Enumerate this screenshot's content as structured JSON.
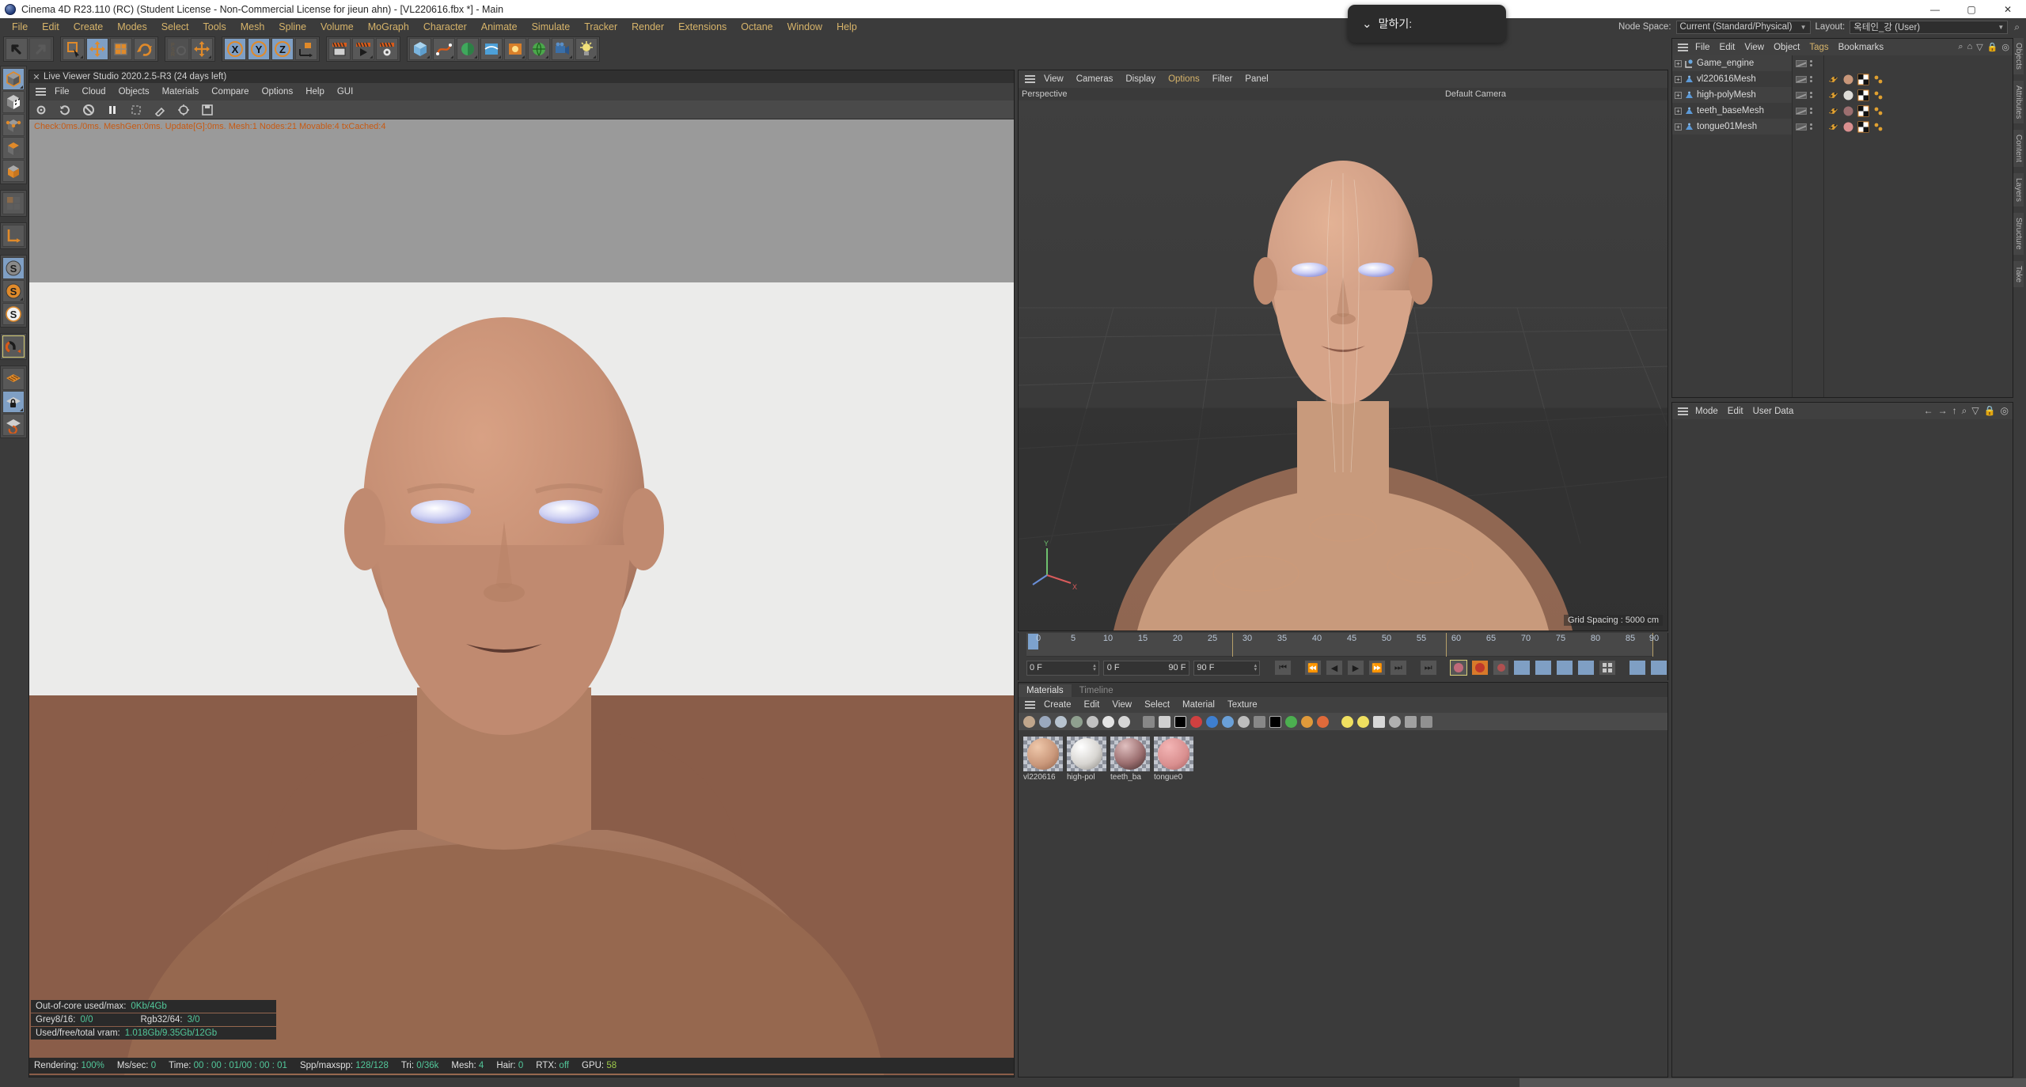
{
  "titlebar": {
    "title": "Cinema 4D R23.110 (RC) (Student License - Non-Commercial License for jieun ahn) - [VL220616.fbx *] - Main",
    "minimize": "—",
    "maximize": "▢",
    "close": "✕"
  },
  "menubar": {
    "items": [
      "File",
      "Edit",
      "Create",
      "Modes",
      "Select",
      "Tools",
      "Mesh",
      "Spline",
      "Volume",
      "MoGraph",
      "Character",
      "Animate",
      "Simulate",
      "Tracker",
      "Render",
      "Extensions",
      "Octane",
      "Window",
      "Help"
    ]
  },
  "topright": {
    "node_space_label": "Node Space:",
    "node_space_value": "Current (Standard/Physical)",
    "layout_label": "Layout:",
    "layout_value": "옥테인_강 (User)",
    "search_icon": "search-icon"
  },
  "speech_overlay": {
    "chevron": "⌄",
    "text": "말하기:"
  },
  "live_viewer": {
    "close_icon": "✕",
    "tab_title": "Live Viewer Studio 2020.2.5-R3 (24 days left)",
    "menu": [
      "File",
      "Cloud",
      "Objects",
      "Materials",
      "Compare",
      "Options",
      "Help",
      "GUI"
    ],
    "stats": "Check:0ms./0ms. MeshGen:0ms. Update[G]:0ms. Mesh:1 Nodes:21 Movable:4 txCached:4",
    "out_of_core": {
      "line1_label": "Out-of-core used/max:",
      "line1_value": "0Kb/4Gb",
      "line2_label_a": "Grey8/16:",
      "line2_value_a": "0/0",
      "line2_label_b": "Rgb32/64:",
      "line2_value_b": "3/0",
      "line3_label": "Used/free/total vram:",
      "line3_value": "1.018Gb/9.35Gb/12Gb"
    },
    "status": {
      "rendering_label": "Rendering:",
      "rendering_value": "100%",
      "mssec_label": "Ms/sec:",
      "mssec_value": "0",
      "time_label": "Time:",
      "time_value": "00 : 00 : 01/00 : 00 : 01",
      "spp_label": "Spp/maxspp:",
      "spp_value": "128/128",
      "tri_label": "Tri:",
      "tri_value": "0/36k",
      "mesh_label": "Mesh:",
      "mesh_value": "4",
      "hair_label": "Hair:",
      "hair_value": "0",
      "rtx_label": "RTX:",
      "rtx_value": "off",
      "gpu_label": "GPU:",
      "gpu_value": "58"
    }
  },
  "viewport": {
    "menu": [
      "View",
      "Cameras",
      "Display",
      "Options",
      "Filter",
      "Panel"
    ],
    "highlighted_menu": "Options",
    "view_name": "Perspective",
    "camera_name": "Default Camera",
    "grid_spacing": "Grid Spacing : 5000 cm"
  },
  "timeline": {
    "ticks": [
      0,
      5,
      10,
      15,
      20,
      25,
      30,
      35,
      40,
      45,
      50,
      55,
      60,
      65,
      70,
      75,
      80,
      85,
      90
    ],
    "current_frame": "0 F",
    "range_start": "0 F",
    "range_end": "90 F",
    "end_frame": "90 F",
    "frame_field": "0 F",
    "transport": [
      "⏮",
      "⏪",
      "◀",
      "▶",
      "⏩",
      "⏭"
    ]
  },
  "materials": {
    "tabs": [
      {
        "label": "Materials",
        "active": true
      },
      {
        "label": "Timeline",
        "active": false
      }
    ],
    "menu": [
      "Create",
      "Edit",
      "View",
      "Select",
      "Material",
      "Texture"
    ],
    "items": [
      {
        "label": "vl220616",
        "color": "#c9977a"
      },
      {
        "label": "high-pol",
        "color": "#d8d6d2"
      },
      {
        "label": "teeth_ba",
        "color": "#9c6f70"
      },
      {
        "label": "tongue0",
        "color": "#d98f8f"
      }
    ]
  },
  "object_manager": {
    "menu": [
      "File",
      "Edit",
      "View",
      "Object",
      "Tags",
      "Bookmarks"
    ],
    "highlighted_menu": "Tags",
    "objects": [
      {
        "name": "Game_engine",
        "type": "null-object",
        "has_tags": false
      },
      {
        "name": "vl220616Mesh",
        "type": "polygon-object",
        "has_tags": true,
        "material_color": "#c9977a"
      },
      {
        "name": "high-polyMesh",
        "type": "polygon-object",
        "has_tags": true,
        "material_color": "#dedcd8"
      },
      {
        "name": "teeth_baseMesh",
        "type": "polygon-object",
        "has_tags": true,
        "material_color": "#9c6f70"
      },
      {
        "name": "tongue01Mesh",
        "type": "polygon-object",
        "has_tags": true,
        "material_color": "#d98f8f"
      }
    ]
  },
  "attributes": {
    "menu": [
      "Mode",
      "Edit",
      "User Data"
    ]
  },
  "right_tabs": [
    "Objects",
    "Attributes",
    "Content",
    "Layers",
    "Structure",
    "Take"
  ],
  "toolbar": {
    "groups": [
      {
        "buttons": [
          {
            "name": "undo-button",
            "icon": "undo",
            "state": "normal"
          },
          {
            "name": "redo-button",
            "icon": "redo",
            "state": "disabled"
          }
        ]
      },
      {
        "buttons": [
          {
            "name": "select-tool",
            "icon": "cursor-square",
            "state": "normal"
          },
          {
            "name": "move-tool",
            "icon": "move-arrows",
            "state": "selected"
          },
          {
            "name": "scale-tool",
            "icon": "scale-box",
            "state": "normal"
          },
          {
            "name": "rotate-tool",
            "icon": "rotate-arc",
            "state": "normal"
          }
        ]
      },
      {
        "buttons": [
          {
            "name": "psr-tool",
            "icon": "psr",
            "state": "disabled"
          },
          {
            "name": "world-axis-tool",
            "icon": "move-arrows",
            "state": "normal"
          }
        ]
      },
      {
        "buttons": [
          {
            "name": "lock-x-axis",
            "icon": "x-axis",
            "state": "selected"
          },
          {
            "name": "lock-y-axis",
            "icon": "y-axis",
            "state": "selected"
          },
          {
            "name": "lock-z-axis",
            "icon": "z-axis",
            "state": "selected"
          },
          {
            "name": "world-object-coord",
            "icon": "cube-axis",
            "state": "normal"
          }
        ]
      },
      {
        "buttons": [
          {
            "name": "render-view-button",
            "icon": "render-view",
            "state": "normal"
          },
          {
            "name": "render-to-picture-viewer-button",
            "icon": "render-picture",
            "state": "normal"
          },
          {
            "name": "render-settings-button",
            "icon": "render-settings",
            "state": "normal"
          }
        ]
      },
      {
        "buttons": [
          {
            "name": "add-cube-button",
            "icon": "cube",
            "state": "normal"
          },
          {
            "name": "add-spline-button",
            "icon": "spline",
            "state": "normal"
          },
          {
            "name": "add-generator-button",
            "icon": "generator",
            "state": "normal"
          },
          {
            "name": "add-deformer-button",
            "icon": "deformer",
            "state": "normal"
          },
          {
            "name": "add-scene-button",
            "icon": "scene",
            "state": "normal"
          },
          {
            "name": "add-camera-button",
            "icon": "camera",
            "state": "normal"
          },
          {
            "name": "add-light-button",
            "icon": "light",
            "state": "normal"
          }
        ]
      }
    ]
  },
  "left_toolbar": {
    "buttons": [
      {
        "name": "model-mode-button",
        "icon": "model-cube",
        "state": "selected"
      },
      {
        "name": "texture-mode-button",
        "icon": "checker-cube",
        "state": "normal"
      },
      {
        "name": "point-mode-button",
        "icon": "point-cube",
        "state": "normal"
      },
      {
        "name": "edge-mode-button",
        "icon": "edge-cube",
        "state": "normal"
      },
      {
        "name": "polygon-mode-button",
        "icon": "poly-cube",
        "state": "normal"
      },
      {
        "name": "uv-mode-button",
        "icon": "uv-grid",
        "state": "disabled"
      },
      {
        "name": "axis-mode-button",
        "icon": "axis-L",
        "state": "normal"
      },
      {
        "name": "enable-axis-button",
        "icon": "s-grey",
        "state": "selected"
      },
      {
        "name": "soft-selection-button",
        "icon": "s-orange",
        "state": "normal"
      },
      {
        "name": "viewport-solo-button",
        "icon": "s-white",
        "state": "normal"
      },
      {
        "name": "snap-magnet-button",
        "icon": "magnet",
        "state": "highlighted"
      },
      {
        "name": "workplane-button",
        "icon": "grid-plane",
        "state": "normal"
      },
      {
        "name": "lock-workplane-button",
        "icon": "grid-lock",
        "state": "selected"
      },
      {
        "name": "workplane-rotate-button",
        "icon": "grid-rotate",
        "state": "normal"
      }
    ]
  }
}
